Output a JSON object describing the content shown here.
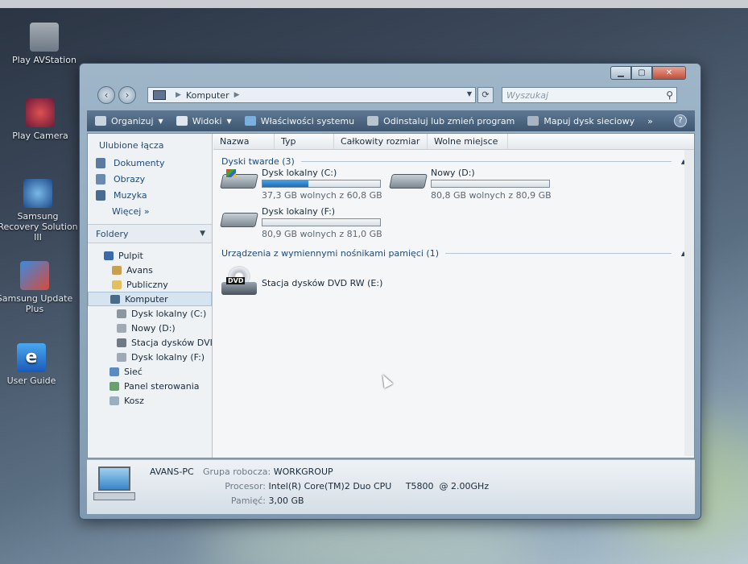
{
  "desktop": {
    "icons": [
      {
        "label": "Play AVStation"
      },
      {
        "label": "Play Camera"
      },
      {
        "label": "Samsung Recovery Solution III"
      },
      {
        "label": "Samsung Update Plus"
      },
      {
        "label": "User Guide"
      }
    ]
  },
  "window": {
    "caption": {
      "minimize": "▁",
      "maximize": "▢",
      "close": "✕"
    },
    "address": {
      "path_root": "Komputer"
    },
    "search": {
      "placeholder": "Wyszukaj"
    },
    "toolbar": {
      "organize": "Organizuj",
      "views": "Widoki",
      "system_properties": "Właściwości systemu",
      "uninstall": "Odinstaluj lub zmień program",
      "map_drive": "Mapuj dysk sieciowy",
      "more": "»"
    },
    "favorites": {
      "title": "Ulubione łącza",
      "items": [
        "Dokumenty",
        "Obrazy",
        "Muzyka"
      ],
      "more": "Więcej  »"
    },
    "folders": {
      "title": "Foldery",
      "tree": [
        "Pulpit",
        "Avans",
        "Publiczny",
        "Komputer",
        "Dysk lokalny (C:)",
        "Nowy (D:)",
        "Stacja dysków DVI",
        "Dysk lokalny (F:)",
        "Sieć",
        "Panel sterowania",
        "Kosz"
      ]
    },
    "columns": [
      "Nazwa",
      "Typ",
      "Całkowity rozmiar",
      "Wolne miejsce"
    ],
    "groups": {
      "hard_disks": "Dyski twarde (3)",
      "removable": "Urządzenia z wymiennymi nośnikami pamięci (1)"
    },
    "drives": [
      {
        "name": "Dysk lokalny (C:)",
        "free_text": "37,3 GB wolnych z 60,8 GB",
        "used_fraction": 0.39
      },
      {
        "name": "Nowy (D:)",
        "free_text": "80,8 GB wolnych z 80,9 GB",
        "used_fraction": 0.0
      },
      {
        "name": "Dysk lokalny (F:)",
        "free_text": "80,9 GB wolnych z 81,0 GB",
        "used_fraction": 0.0
      }
    ],
    "dvd": {
      "name": "Stacja dysków DVD RW (E:)",
      "badge": "DVD"
    },
    "details": {
      "computer_name": "AVANS-PC",
      "workgroup_label": "Grupa robocza:",
      "workgroup_value": "WORKGROUP",
      "cpu_label": "Procesor:",
      "cpu_value": "Intel(R) Core(TM)2 Duo CPU     T5800  @ 2.00GHz",
      "ram_label": "Pamięć:",
      "ram_value": "3,00 GB"
    }
  }
}
